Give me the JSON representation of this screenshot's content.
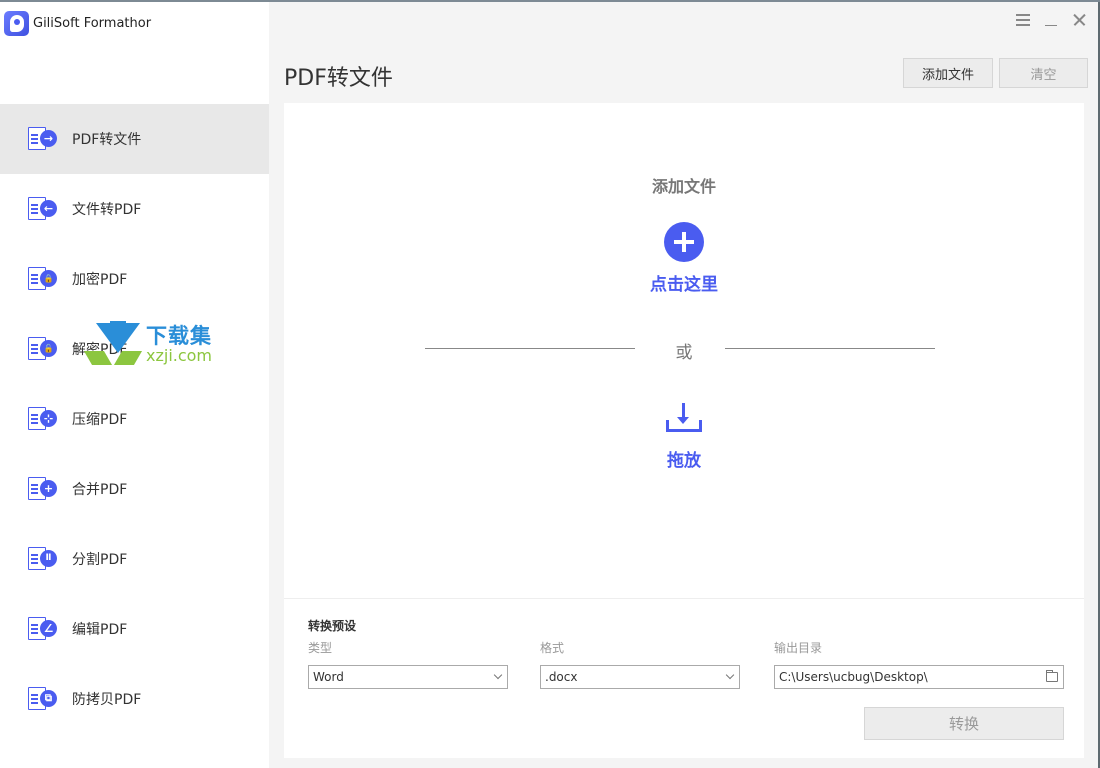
{
  "app": {
    "name": "GiliSoft Formathor"
  },
  "window_controls": [
    "menu-icon",
    "minimize-icon",
    "close-icon"
  ],
  "sidebar": {
    "items": [
      {
        "label": "PDF转文件",
        "icon": "pdf-to-file-icon",
        "glyph": "→",
        "active": true
      },
      {
        "label": "文件转PDF",
        "icon": "file-to-pdf-icon",
        "glyph": "←",
        "active": false
      },
      {
        "label": "加密PDF",
        "icon": "lock-icon",
        "glyph": "🔒",
        "active": false
      },
      {
        "label": "解密PDF",
        "icon": "unlock-icon",
        "glyph": "🔓",
        "active": false
      },
      {
        "label": "压缩PDF",
        "icon": "compress-icon",
        "glyph": "⊹",
        "active": false
      },
      {
        "label": "合并PDF",
        "icon": "merge-icon",
        "glyph": "+",
        "active": false
      },
      {
        "label": "分割PDF",
        "icon": "split-icon",
        "glyph": "Ⅱ",
        "active": false
      },
      {
        "label": "编辑PDF",
        "icon": "edit-icon",
        "glyph": "∠",
        "active": false
      },
      {
        "label": "防拷贝PDF",
        "icon": "copy-protect-icon",
        "glyph": "⧉",
        "active": false
      }
    ]
  },
  "watermark": {
    "cn": "下载集",
    "en": "xzji.com"
  },
  "main": {
    "title": "PDF转文件",
    "add_file_button": "添加文件",
    "clear_button": "清空",
    "drop_zone": {
      "title": "添加文件",
      "click_here": "点击这里",
      "or": "或",
      "drag_drop": "拖放"
    },
    "settings": {
      "title": "转换预设",
      "type_label": "类型",
      "type_value": "Word",
      "format_label": "格式",
      "format_value": ".docx",
      "output_label": "输出目录",
      "output_value": "C:\\Users\\ucbug\\Desktop\\",
      "convert_button": "转换"
    }
  },
  "colors": {
    "accent": "#4a5cf0",
    "sidebar_active": "#e8e8e8",
    "background": "#f4f4f4"
  }
}
